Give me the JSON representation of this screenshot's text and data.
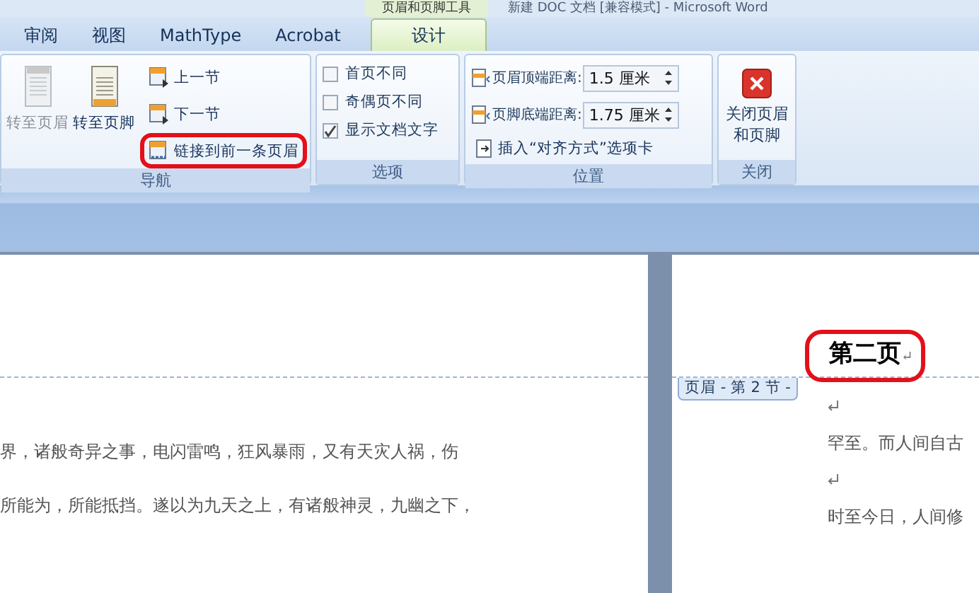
{
  "window": {
    "context_group": "页眉和页脚工具",
    "title": "新建 DOC 文档 [兼容模式] - Microsoft Word"
  },
  "tabs": [
    {
      "label": "审阅",
      "selected": false
    },
    {
      "label": "视图",
      "selected": false
    },
    {
      "label": "MathType",
      "selected": false
    },
    {
      "label": "Acrobat",
      "selected": false
    },
    {
      "label": "设计",
      "selected": true
    }
  ],
  "ribbon": {
    "navigation": {
      "label": "导航",
      "large_buttons": [
        {
          "label": "转至页眉",
          "disabled": true
        },
        {
          "label": "转至页脚",
          "disabled": false
        }
      ],
      "small_buttons": [
        {
          "label": "上一节",
          "kind": "prev",
          "highlighted": false
        },
        {
          "label": "下一节",
          "kind": "next",
          "highlighted": false
        },
        {
          "label": "链接到前一条页眉",
          "kind": "link",
          "highlighted": true
        }
      ]
    },
    "options": {
      "label": "选项",
      "checkboxes": [
        {
          "label": "首页不同",
          "checked": false
        },
        {
          "label": "奇偶页不同",
          "checked": false
        },
        {
          "label": "显示文档文字",
          "checked": true
        }
      ]
    },
    "position": {
      "label": "位置",
      "spinners": [
        {
          "label": "页眉顶端距离:",
          "value": "1.5 厘米"
        },
        {
          "label": "页脚底端距离:",
          "value": "1.75 厘米"
        }
      ],
      "insert_button": "插入“对齐方式”选项卡"
    },
    "close": {
      "label": "关闭",
      "button": "关闭页眉和页脚"
    }
  },
  "pages": [
    {
      "lines": [
        "界，诸般奇异之事，电闪雷鸣，狂风暴雨，又有天灾人祸，伤",
        "所能为，所能抵挡。遂以为九天之上，有诸般神灵，九幽之下，"
      ]
    },
    {
      "header_text": "第二页",
      "header_mark": "↵",
      "header_highlighted": true,
      "header_tag": "页眉 - 第 2 节 -",
      "lines": [
        "罕至。而人间自古",
        "时至今日，人间修"
      ]
    }
  ]
}
